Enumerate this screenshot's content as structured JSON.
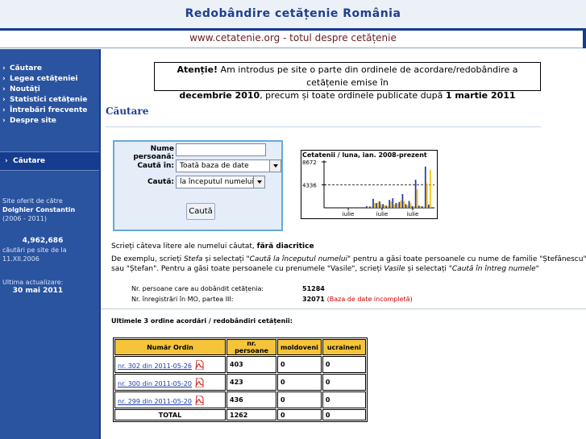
{
  "header": {
    "title": "Redobândire cetățenie România",
    "subtitle": "www.cetatenie.org - totul despre cetățenie"
  },
  "sidebar": {
    "items": [
      {
        "label": "Căutare"
      },
      {
        "label": "Legea cetățeniei"
      },
      {
        "label": "Noutăți"
      },
      {
        "label": "Statistici cetățenie"
      },
      {
        "label": "Întrebări frecvente"
      },
      {
        "label": "Despre site"
      }
    ],
    "active_box_label": "Căutare",
    "offered_by_prefix": "Site oferit de către",
    "author": "Dolghier Constantin",
    "years": "(2006 - 2011)",
    "search_count": "4,962,686",
    "search_count_label_1": "căutări pe site de la",
    "search_count_label_2": "11.XII.2006",
    "last_update_label": "Ultima actualizare:",
    "last_update_date": "30 mai 2011"
  },
  "notice": {
    "bold_start": "Atenție!",
    "text_1": " Am introdus pe site o parte din ordinele de acordare/redobândire a cetățenie emise în",
    "bold_mid": "decembrie 2010",
    "text_2": ", precum și toate ordinele publicate după ",
    "bold_end": "1 martie 2011"
  },
  "search": {
    "section_title": "Căutare",
    "name_label": "Nume persoană:",
    "name_value": "",
    "in_label": "Caută în:",
    "in_value": "Toată baza de date",
    "mode_label": "Caută:",
    "mode_value": "la începutul numelui",
    "button_label": "Caută"
  },
  "chart_data": {
    "type": "bar",
    "title": "Cetatenii / luna, ian. 2008-prezent",
    "y_ticks": [
      "8672",
      "4336"
    ],
    "x_tick_labels": [
      "iulie",
      "iulie",
      "iulie"
    ],
    "dashed_reference": 4336,
    "ylim": [
      0,
      8672
    ],
    "series": [
      {
        "color": "#2b34a6",
        "values": [
          300,
          250,
          1700,
          900,
          1200,
          700,
          400,
          1500,
          1800,
          900,
          1100,
          2600,
          700,
          1300,
          350,
          5300,
          400,
          300,
          7800,
          600
        ]
      },
      {
        "color": "#f4c400",
        "values": [
          200,
          180,
          900,
          1100,
          700,
          500,
          300,
          1200,
          600,
          800,
          1400,
          1300,
          500,
          900,
          250,
          3500,
          300,
          200,
          4600,
          7200
        ]
      }
    ],
    "legend": "none",
    "grid": false
  },
  "instructions": {
    "line1_pre": "Scrieți câteva litere ale numelui căutat, ",
    "line1_bold": "fără diacritice",
    "line2_pre": "De exemplu, scrieți ",
    "line2_it1": "Stefa",
    "line2_mid1": " și selectați \"",
    "line2_it2": "Caută la începutul numelui",
    "line2_post": "\" pentru a găsi toate persoanele cu nume de familie \"Ștefănescu\"",
    "line3_pre": "sau \"Ștefan\". Pentru a găsi toate persoanele cu prenumele \"Vasile\", scrieți ",
    "line3_it1": "Vasile",
    "line3_mid": " și selectați ",
    "line3_it2": "\"Caută în întreg numele\""
  },
  "stats": {
    "persons_label": "Nr. persoane care au dobândit cetățenia:",
    "persons_value": "51284",
    "records_label": "Nr. înregistrări în MO, partea III:",
    "records_value": "32071",
    "records_note": "(Baza de date incompletă)"
  },
  "orders": {
    "title": "Ultimele 3 ordine acordări / redobândiri cetățenii:",
    "headers": [
      "Număr Ordin",
      "nr. persoane",
      "moldoveni",
      "ucraineni"
    ],
    "rows": [
      {
        "order": "nr. 302 din 2011-05-26",
        "persons": "403",
        "moldovans": "0",
        "ukrainians": "0"
      },
      {
        "order": "nr. 300 din 2011-05-20",
        "persons": "423",
        "moldovans": "0",
        "ukrainians": "0"
      },
      {
        "order": "nr. 299 din 2011-05-20",
        "persons": "436",
        "moldovans": "0",
        "ukrainians": "0"
      }
    ],
    "total": {
      "label": "TOTAL",
      "persons": "1262",
      "moldovans": "0",
      "ukrainians": "0"
    }
  },
  "colors": {
    "brand_blue": "#2a53a0",
    "dark_blue": "#153c8e",
    "table_header": "#f5c43a",
    "search_border": "#65a9d9"
  }
}
